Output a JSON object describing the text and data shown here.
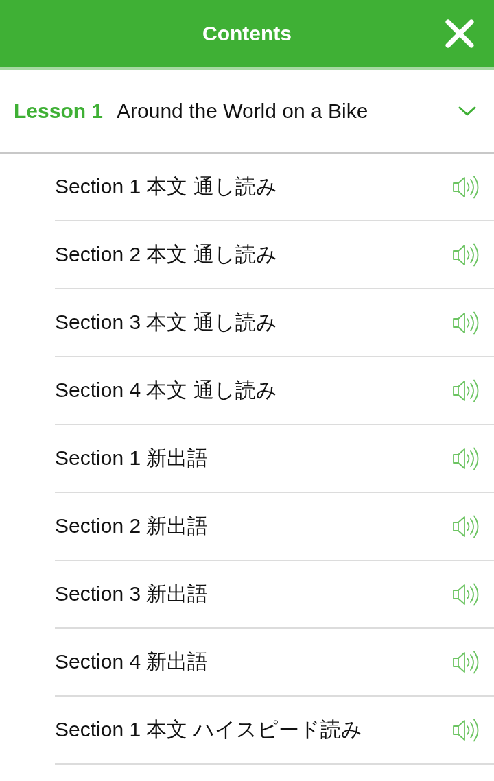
{
  "header": {
    "title": "Contents"
  },
  "lesson": {
    "number": "Lesson 1",
    "title": "Around the World on a Bike",
    "expanded": true
  },
  "sections": [
    {
      "label": "Section 1 本文 通し読み"
    },
    {
      "label": "Section 2 本文 通し読み"
    },
    {
      "label": "Section 3 本文 通し読み"
    },
    {
      "label": "Section 4 本文 通し読み"
    },
    {
      "label": "Section 1 新出語"
    },
    {
      "label": "Section 2 新出語"
    },
    {
      "label": "Section 3 新出語"
    },
    {
      "label": "Section 4 新出語"
    },
    {
      "label": "Section 1 本文 ハイスピード読み"
    }
  ]
}
